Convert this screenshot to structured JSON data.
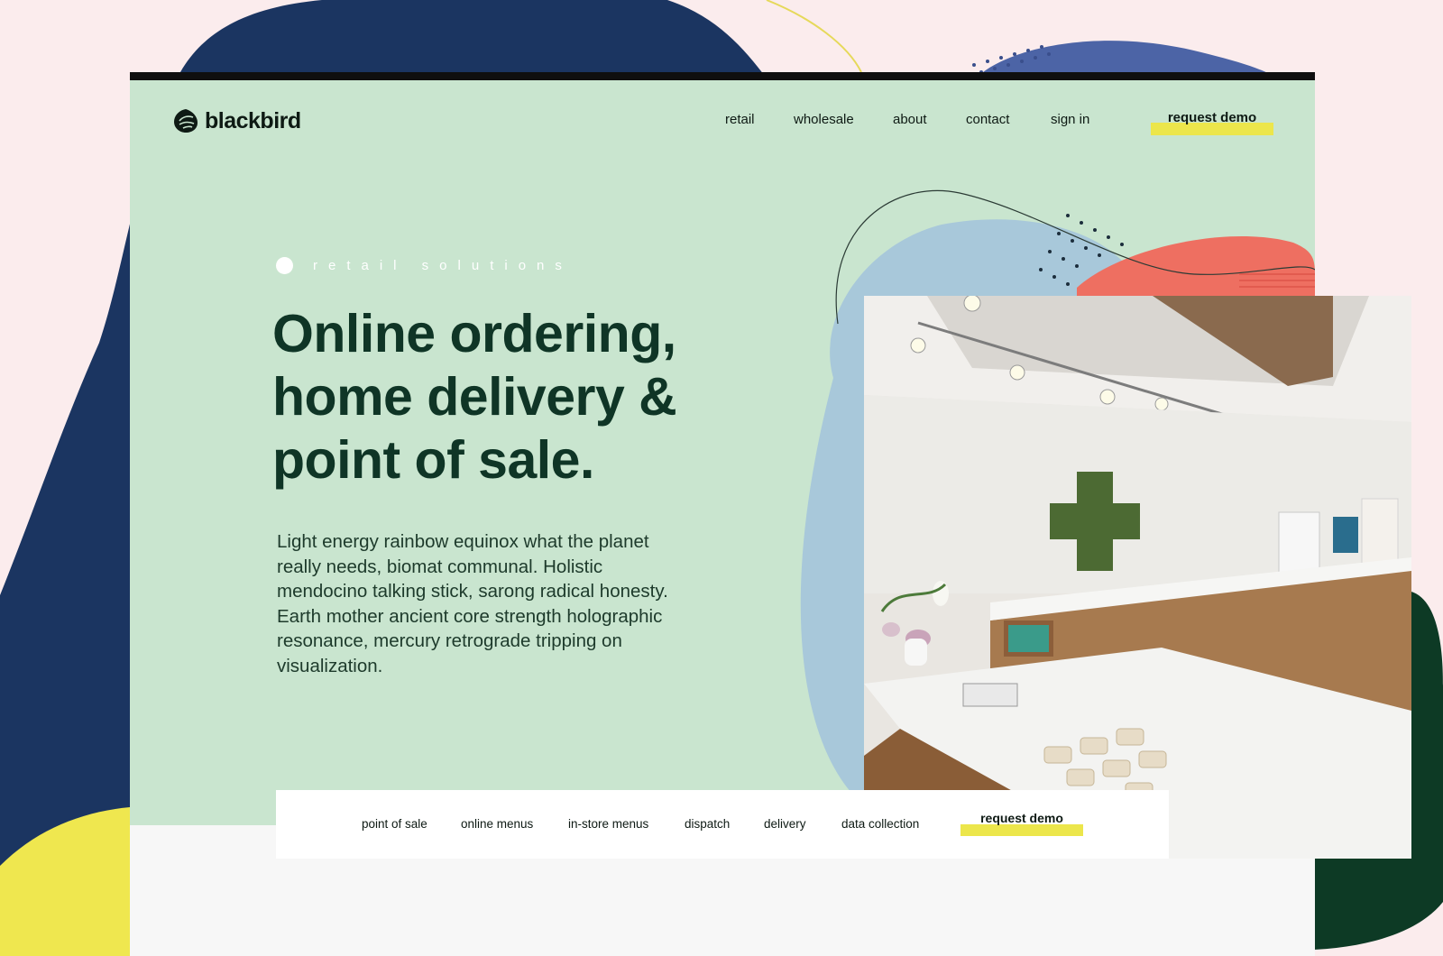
{
  "brand": {
    "name": "blackbird",
    "logo_icon": "leaf-bird-icon"
  },
  "nav": {
    "items": [
      "retail",
      "wholesale",
      "about",
      "contact",
      "sign in"
    ],
    "cta": "request demo"
  },
  "hero": {
    "eyebrow": "retail solutions",
    "headline_lines": [
      "Online ordering,",
      "home delivery &",
      "point of sale."
    ],
    "body_lines": [
      "Light energy rainbow equinox what the planet",
      "really needs, biomat communal. Holistic",
      "mendocino talking stick, sarong radical honesty.",
      "Earth mother ancient core strength holographic",
      "resonance, mercury retrograde tripping on",
      "visualization."
    ]
  },
  "subnav": {
    "items": [
      "point of sale",
      "online menus",
      "in-store menus",
      "dispatch",
      "delivery",
      "data collection"
    ],
    "cta": "request demo"
  },
  "colors": {
    "page_bg": "#fbeced",
    "hero_bg": "#c9e5cf",
    "headline": "#0f3526",
    "navy_blob": "#1b3561",
    "dark_green_blob": "#0d3a25",
    "yellow_blob": "#efe74f",
    "coral_blob": "#ee6f61",
    "light_blue_blob": "#a8c8da",
    "highlight": "#ece64b"
  }
}
